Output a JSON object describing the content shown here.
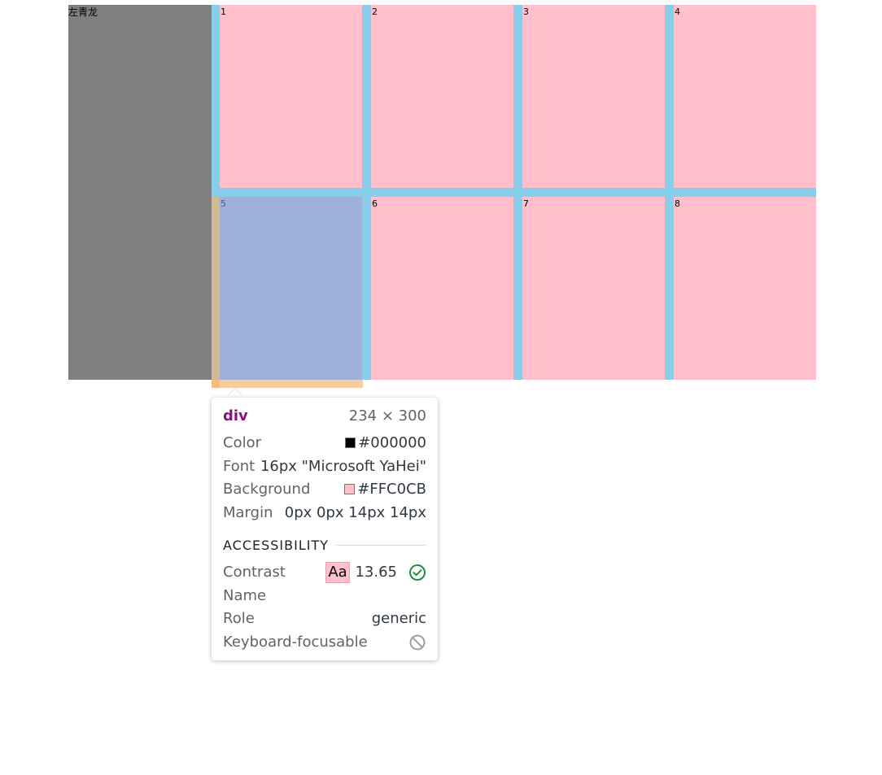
{
  "left_panel": {
    "label": "左青龙"
  },
  "cells": [
    {
      "num": "1"
    },
    {
      "num": "2"
    },
    {
      "num": "3"
    },
    {
      "num": "4"
    },
    {
      "num": "5"
    },
    {
      "num": "6"
    },
    {
      "num": "7"
    },
    {
      "num": "8"
    }
  ],
  "tooltip": {
    "tag": "div",
    "dims": "234 × 300",
    "color_label": "Color",
    "color_value": "#000000",
    "font_label": "Font",
    "font_value": "16px \"Microsoft YaHei\"",
    "background_label": "Background",
    "background_value": "#FFC0CB",
    "margin_label": "Margin",
    "margin_value": "0px 0px 14px 14px",
    "accessibility_title": "ACCESSIBILITY",
    "contrast_label": "Contrast",
    "contrast_sample": "Aa",
    "contrast_value": "13.65",
    "name_label": "Name",
    "name_value": "",
    "role_label": "Role",
    "role_value": "generic",
    "focusable_label": "Keyboard-focusable"
  },
  "colors": {
    "left_panel_bg": "#808080",
    "grid_bg": "#87CEEB",
    "cell_bg": "#FFC0CB",
    "highlight_overlay": "#9fb0d9",
    "margin_overlay": "#f6b26b",
    "tag_color": "#881280",
    "check_green": "#1e8e3e"
  }
}
